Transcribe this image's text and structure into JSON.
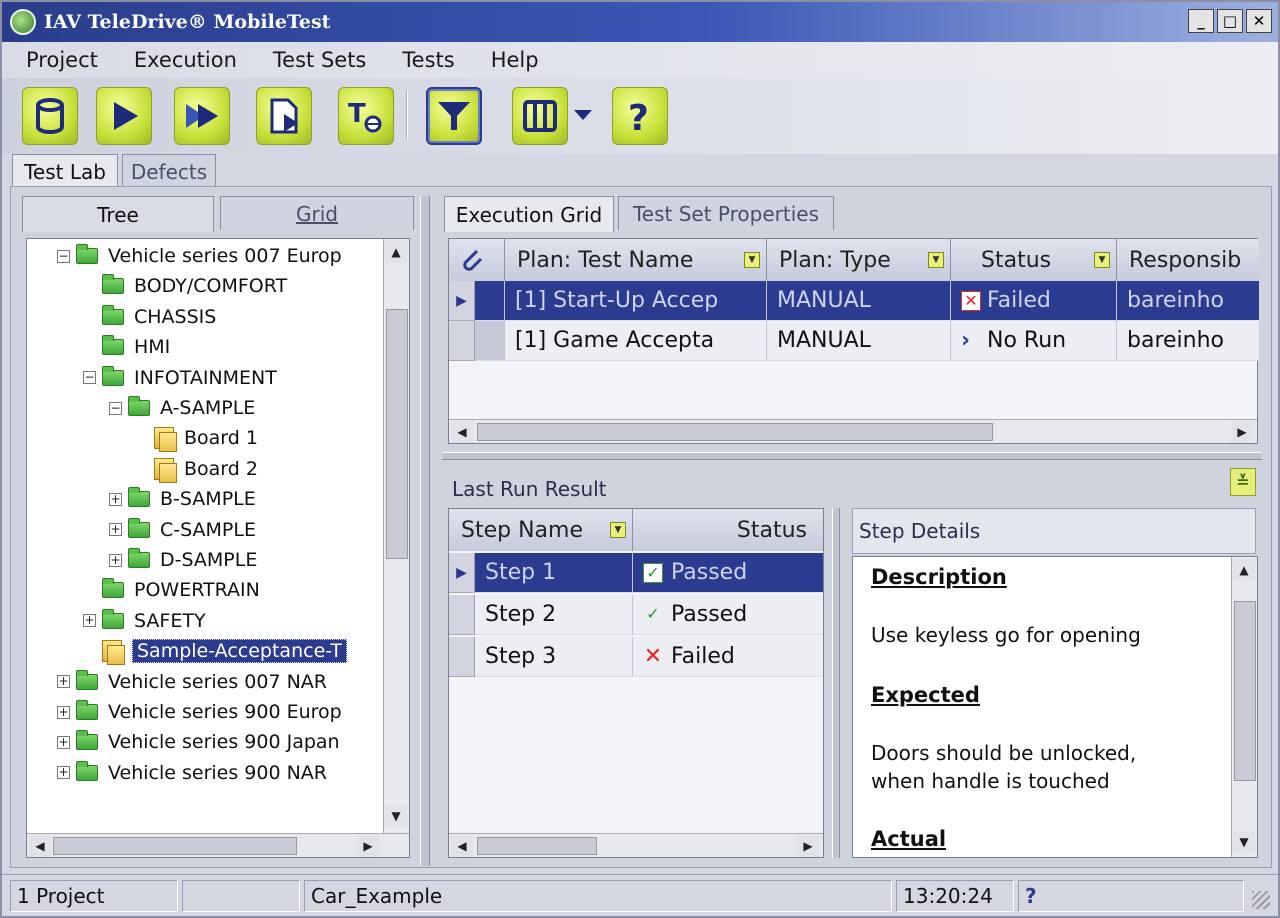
{
  "window": {
    "title": "IAV TeleDrive® MobileTest"
  },
  "menu": [
    "Project",
    "Execution",
    "Test Sets",
    "Tests",
    "Help"
  ],
  "top_tabs": {
    "test_lab": "Test Lab",
    "defects": "Defects"
  },
  "left_tabs": {
    "tree": "Tree",
    "grid": "Grid"
  },
  "tree": [
    {
      "label": "Vehicle series 007 Europ",
      "level": 0,
      "expander": "−",
      "icon": "folder-open"
    },
    {
      "label": "BODY/COMFORT",
      "level": 1,
      "icon": "folder"
    },
    {
      "label": "CHASSIS",
      "level": 1,
      "icon": "folder"
    },
    {
      "label": "HMI",
      "level": 1,
      "icon": "folder"
    },
    {
      "label": "INFOTAINMENT",
      "level": 1,
      "expander": "−",
      "icon": "folder-open"
    },
    {
      "label": "A-SAMPLE",
      "level": 2,
      "expander": "−",
      "icon": "folder-open"
    },
    {
      "label": "Board 1",
      "level": 3,
      "icon": "test-set"
    },
    {
      "label": "Board 2",
      "level": 3,
      "icon": "test-set"
    },
    {
      "label": "B-SAMPLE",
      "level": 2,
      "expander": "+",
      "icon": "folder"
    },
    {
      "label": "C-SAMPLE",
      "level": 2,
      "expander": "+",
      "icon": "folder"
    },
    {
      "label": "D-SAMPLE",
      "level": 2,
      "expander": "+",
      "icon": "folder"
    },
    {
      "label": "POWERTRAIN",
      "level": 1,
      "icon": "folder"
    },
    {
      "label": "SAFETY",
      "level": 1,
      "expander": "+",
      "icon": "folder"
    },
    {
      "label": "Sample-Acceptance-T",
      "level": 1,
      "icon": "test-set",
      "selected": true
    },
    {
      "label": "Vehicle series 007 NAR",
      "level": 0,
      "expander": "+",
      "icon": "folder"
    },
    {
      "label": "Vehicle series 900 Europ",
      "level": 0,
      "expander": "+",
      "icon": "folder"
    },
    {
      "label": "Vehicle series 900 Japan",
      "level": 0,
      "expander": "+",
      "icon": "folder"
    },
    {
      "label": "Vehicle series 900 NAR",
      "level": 0,
      "expander": "+",
      "icon": "folder"
    }
  ],
  "right_tabs": {
    "execution_grid": "Execution Grid",
    "test_set_properties": "Test Set Properties"
  },
  "exec_grid": {
    "headers": [
      "Plan: Test Name",
      "Plan: Type",
      "Status",
      "Responsib"
    ],
    "rows": [
      {
        "name": "[1] Start-Up Accep",
        "type": "MANUAL",
        "status": "Failed",
        "status_icon": "failed-icon",
        "responsible": "bareinho",
        "selected": true
      },
      {
        "name": "[1] Game Accepta",
        "type": "MANUAL",
        "status": "No Run",
        "status_icon": "norun-icon",
        "responsible": "bareinho",
        "selected": false
      }
    ]
  },
  "last_run": {
    "label": "Last Run Result",
    "headers": [
      "Step Name",
      "Status"
    ],
    "rows": [
      {
        "name": "Step 1",
        "status": "Passed",
        "status_icon": "passed-icon",
        "selected": true
      },
      {
        "name": "Step 2",
        "status": "Passed",
        "status_icon": "passed-icon",
        "selected": false
      },
      {
        "name": "Step 3",
        "status": "Failed",
        "status_icon": "failed-icon",
        "selected": false
      }
    ]
  },
  "step_details": {
    "label": "Step Details",
    "description_head": "Description",
    "description": "Use keyless go for opening",
    "expected_head": "Expected",
    "expected_line1": "Doors should be unlocked,",
    "expected_line2": "when handle is touched",
    "actual_head": "Actual"
  },
  "statusbar": {
    "project": "1 Project",
    "blank": "",
    "name": "Car_Example",
    "time": "13:20:24",
    "help": "?"
  },
  "colors": {
    "selection": "#2b3b8f",
    "toolbar_button": "#c8e03a",
    "title_bar": "#2a3d8c"
  }
}
